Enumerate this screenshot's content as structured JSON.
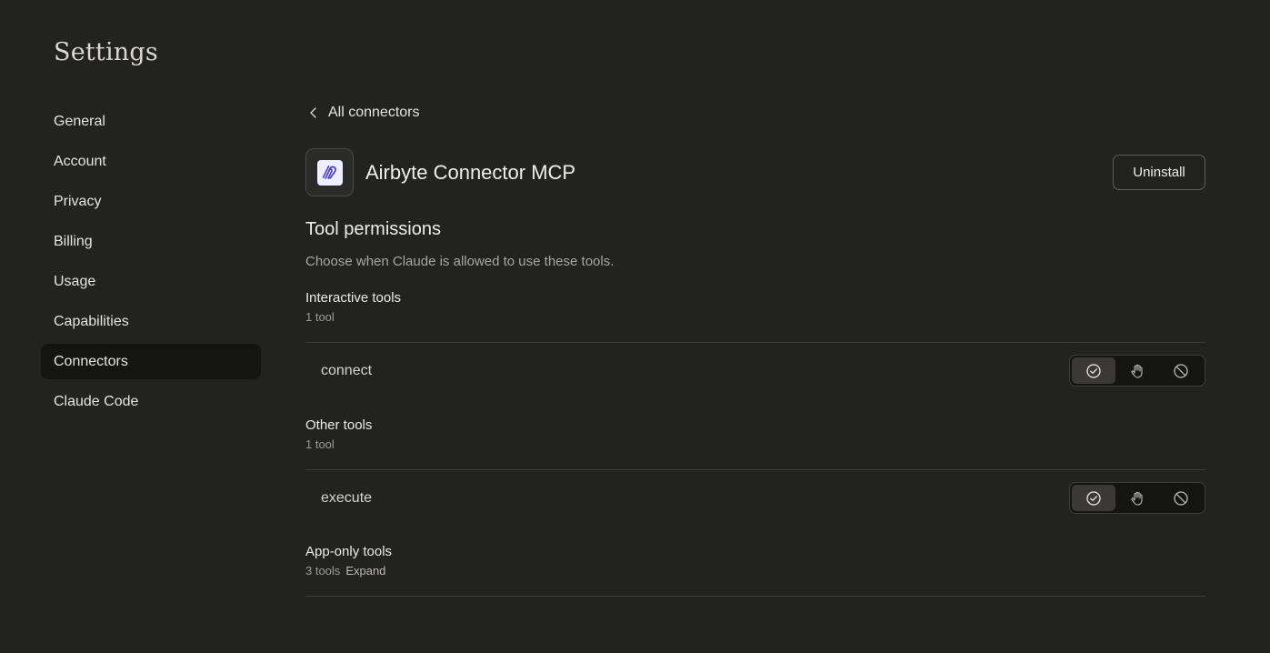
{
  "page": {
    "title": "Settings"
  },
  "sidebar": {
    "items": [
      {
        "label": "General",
        "active": false
      },
      {
        "label": "Account",
        "active": false
      },
      {
        "label": "Privacy",
        "active": false
      },
      {
        "label": "Billing",
        "active": false
      },
      {
        "label": "Usage",
        "active": false
      },
      {
        "label": "Capabilities",
        "active": false
      },
      {
        "label": "Connectors",
        "active": true
      },
      {
        "label": "Claude Code",
        "active": false
      }
    ]
  },
  "breadcrumb": {
    "back_label": "All connectors",
    "back_icon": "chevron-left-icon"
  },
  "connector": {
    "name": "Airbyte Connector MCP",
    "logo_icon": "airbyte-logo",
    "uninstall_label": "Uninstall"
  },
  "permissions": {
    "title": "Tool permissions",
    "description": "Choose when Claude is allowed to use these tools.",
    "option_icons": [
      "check-circle-icon",
      "hand-icon",
      "block-icon"
    ],
    "groups": [
      {
        "title": "Interactive tools",
        "count": "1 tool",
        "tools": [
          {
            "name": "connect",
            "selected": "check-circle-icon"
          }
        ]
      },
      {
        "title": "Other tools",
        "count": "1 tool",
        "tools": [
          {
            "name": "execute",
            "selected": "check-circle-icon"
          }
        ]
      },
      {
        "title": "App-only tools",
        "count": "3 tools",
        "expand_label": "Expand",
        "tools": []
      }
    ]
  },
  "colors": {
    "background": "#222221",
    "active_nav": "#141413",
    "divider": "#3c3b39",
    "logo_accent": "#4b3fd8"
  }
}
